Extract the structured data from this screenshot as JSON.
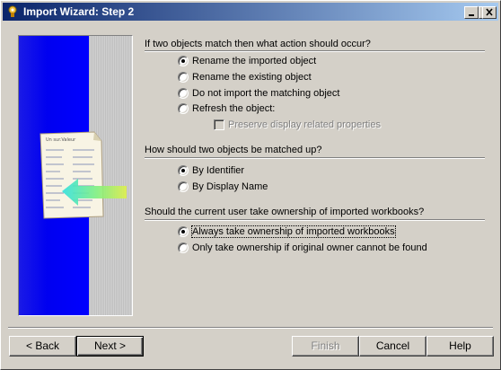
{
  "window": {
    "title": "Import Wizard: Step 2",
    "controls": {
      "minimize_icon": "minimize-icon",
      "maximize_icon": "maximize-icon",
      "close_icon": "close-icon"
    }
  },
  "colors": {
    "titlebar_start": "#0a246a",
    "titlebar_end": "#a6caf0",
    "banner_blue": "#0000ff",
    "face": "#d4d0c8"
  },
  "sections": {
    "action": {
      "header": "If two objects match then what action should occur?",
      "options": [
        "Rename the imported object",
        "Rename the existing object",
        "Do not import the matching object",
        "Refresh the object:"
      ],
      "selected": "Rename the imported object",
      "subcheck": {
        "label": "Preserve display related properties",
        "checked": false,
        "enabled": false
      }
    },
    "match": {
      "header": "How should two objects be matched up?",
      "options": [
        "By Identifier",
        "By Display Name"
      ],
      "selected": "By Identifier"
    },
    "ownership": {
      "header": "Should the current user take ownership of imported workbooks?",
      "options": [
        "Always take ownership of imported workbooks",
        "Only take ownership if original owner cannot be found"
      ],
      "selected": "Always take ownership of imported workbooks"
    }
  },
  "buttons": {
    "back": "< Back",
    "next": "Next >",
    "finish": "Finish",
    "cancel": "Cancel",
    "help": "Help"
  },
  "banner": {
    "doc_text": "Un sur.Valeur",
    "icons": [
      "document-icon",
      "import-arrow-icon"
    ]
  }
}
